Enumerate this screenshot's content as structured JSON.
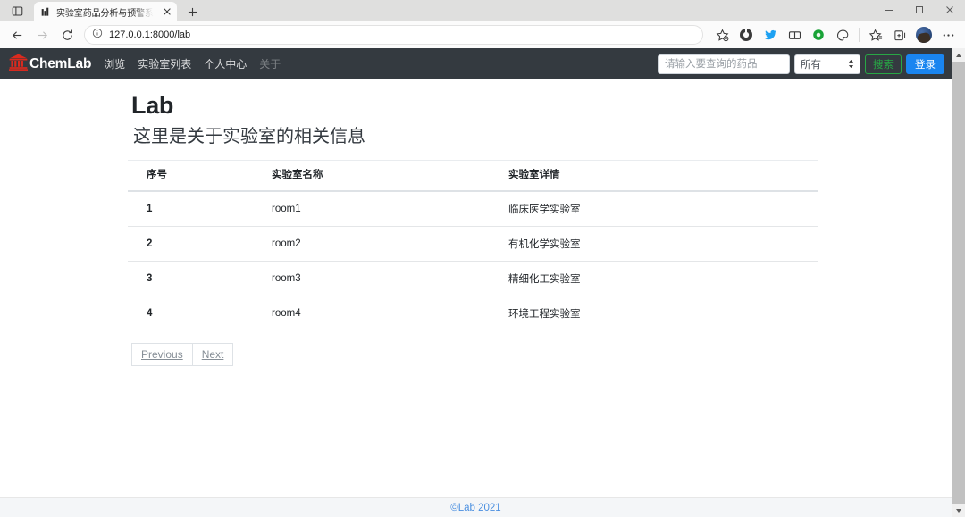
{
  "browser": {
    "tab": {
      "title": "实验室药品分析与预警系统 -实验",
      "favicon_name": "site-favicon",
      "close_label": "×"
    },
    "new_tab_label": "+",
    "window_controls": {
      "minimize": "−",
      "maximize": "▢",
      "close": "✕"
    },
    "toolbar": {
      "back_icon": "back-arrow-icon",
      "forward_icon": "forward-arrow-icon",
      "reload_icon": "reload-icon",
      "info_icon": "site-info-icon",
      "url": "127.0.0.1:8000/lab",
      "url_host": "127.0.0.1",
      "url_rest": ":8000/lab",
      "favorite_icon": "add-favorite-icon",
      "extensions": [
        "collections-icon",
        "twitter-extension-icon",
        "split-screen-icon",
        "green-dot-extension-icon",
        "browser-essentials-icon"
      ],
      "favorites_bar_icon": "favorites-icon",
      "collections_icon": "collections-panel-icon",
      "profile_icon": "profile-avatar",
      "settings_icon": "more-options-icon"
    }
  },
  "site": {
    "navbar": {
      "brand": "ChemLab",
      "brand_icon": "university-icon",
      "brand_color": "#dc2a1e",
      "links": [
        {
          "label": "浏览",
          "disabled": false
        },
        {
          "label": "实验室列表",
          "disabled": false
        },
        {
          "label": "个人中心",
          "disabled": false
        },
        {
          "label": "关于",
          "disabled": true
        }
      ],
      "search": {
        "placeholder": "请输入要查询的药品",
        "value": "",
        "select_value": "所有",
        "select_options": [
          "所有"
        ],
        "search_button": "搜索",
        "login_button": "登录",
        "search_color": "#28a745",
        "login_color": "#1a85f0"
      },
      "background": "#343a40"
    },
    "main": {
      "title": "Lab",
      "subtitle": "这里是关于实验室的相关信息",
      "table": {
        "columns": [
          "序号",
          "实验室名称",
          "实验室详情"
        ],
        "rows": [
          [
            "1",
            "room1",
            "临床医学实验室"
          ],
          [
            "2",
            "room2",
            "有机化学实验室"
          ],
          [
            "3",
            "room3",
            "精细化工实验室"
          ],
          [
            "4",
            "room4",
            "环境工程实验室"
          ]
        ]
      },
      "pagination": {
        "previous": "Previous",
        "next": "Next"
      }
    },
    "footer": {
      "text": "©Lab 2021",
      "color": "#4a8fe0"
    }
  },
  "scrollbar": {
    "up": "▴",
    "down": "▾"
  }
}
